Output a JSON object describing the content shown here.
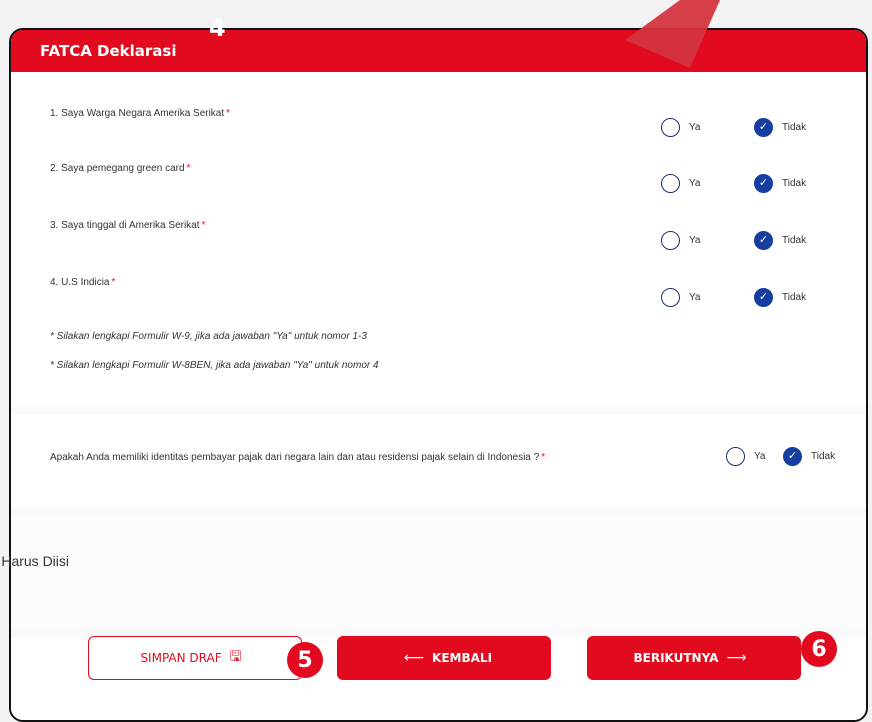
{
  "header": {
    "title": "FATCA Deklarasi"
  },
  "questions": [
    {
      "label": "1. Saya Warga Negara Amerika Serikat",
      "options": [
        "Ya",
        "Tidak"
      ],
      "selected": "Tidak"
    },
    {
      "label": "2. Saya pemegang green card",
      "options": [
        "Ya",
        "Tidak"
      ],
      "selected": "Tidak"
    },
    {
      "label": "3. Saya tinggal di Amerika Serikat",
      "options": [
        "Ya",
        "Tidak"
      ],
      "selected": "Tidak"
    },
    {
      "label": "4. U.S Indicia",
      "options": [
        "Ya",
        "Tidak"
      ],
      "selected": "Tidak"
    }
  ],
  "required_mark": "*",
  "notes": [
    "* Silakan lengkapi Formulir W-9, jika ada jawaban \"Ya\" untuk nomor 1-3",
    "* Silakan lengkapi Formulir W-8BEN, jika ada jawaban \"Ya\" untuk nomor 4"
  ],
  "tax_question": {
    "label": "Apakah Anda memiliki identitas pembayar pajak dari negara lain dan atau residensi pajak selain di Indonesia ?",
    "options": [
      "Ya",
      "Tidak"
    ],
    "selected": "Tidak"
  },
  "required_note": "* Harus Diisi",
  "buttons": {
    "save_draft": "SIMPAN DRAF",
    "back": "KEMBALI",
    "next": "BERIKUTNYA",
    "back_arrow": "⟵",
    "next_arrow": "⟶",
    "save_icon": "🖫"
  },
  "badges": {
    "b4": "4",
    "b5": "5",
    "b6": "6"
  },
  "check_glyph": "✓",
  "colors": {
    "brand_red": "#e10a1e",
    "radio_blue": "#163ea0"
  }
}
